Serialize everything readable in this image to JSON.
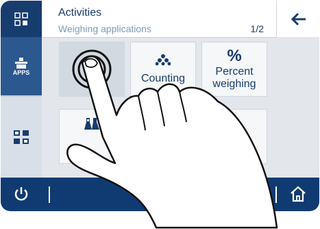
{
  "header": {
    "title": "Activities",
    "subtitle": "Weighing applications",
    "page_indicator": "1/2"
  },
  "sidebar": {
    "apps_label": "APPS"
  },
  "tiles": [
    {
      "label": "",
      "icon": "weighing-icon"
    },
    {
      "label": "Counting",
      "icon": "counting-dots-icon"
    },
    {
      "label": "Percent\nweighing",
      "icon": "percent-icon"
    },
    {
      "label": "",
      "icon": "flasks-icon"
    }
  ],
  "percent_symbol": "%",
  "colors": {
    "navy": "#173c6e",
    "footer": "#0f3b72",
    "sidebar_mid": "#2b588f",
    "tile_bg": "#f5f7f9",
    "text": "#173c6e"
  }
}
